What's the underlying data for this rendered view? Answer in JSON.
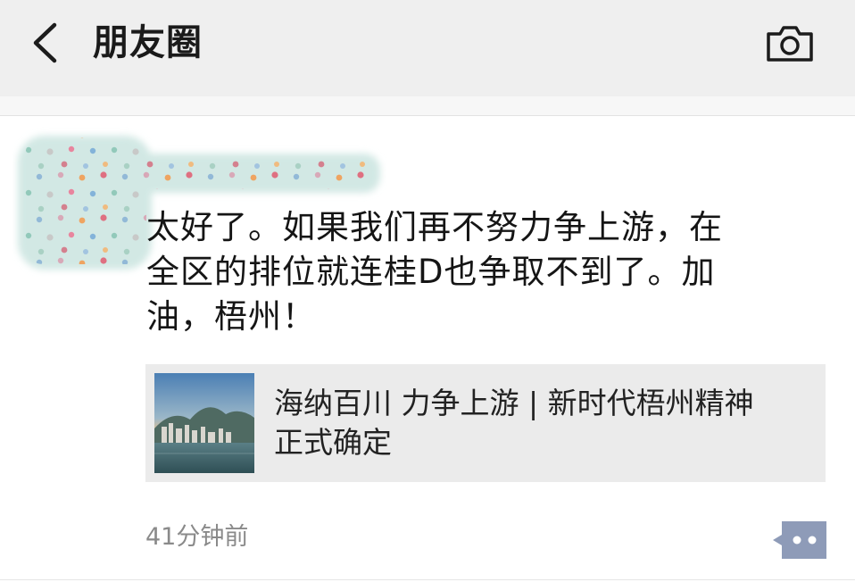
{
  "header": {
    "title": "朋友圈",
    "back_icon": "chevron-left-icon",
    "camera_icon": "camera-icon",
    "background": "#efefef"
  },
  "post": {
    "text": "太好了。如果我们再不努力争上游，在\n全区的排位就连桂D也争取不到了。加\n油，梧州！",
    "link": {
      "title": "海纳百川 力争上游 | 新时代梧州精神\n正式确定",
      "thumbnail_icon": "city-skyline-thumbnail"
    },
    "time": "41分钟前",
    "more_icon": "comment-more-icon",
    "more_color": "#8e9bb8"
  }
}
